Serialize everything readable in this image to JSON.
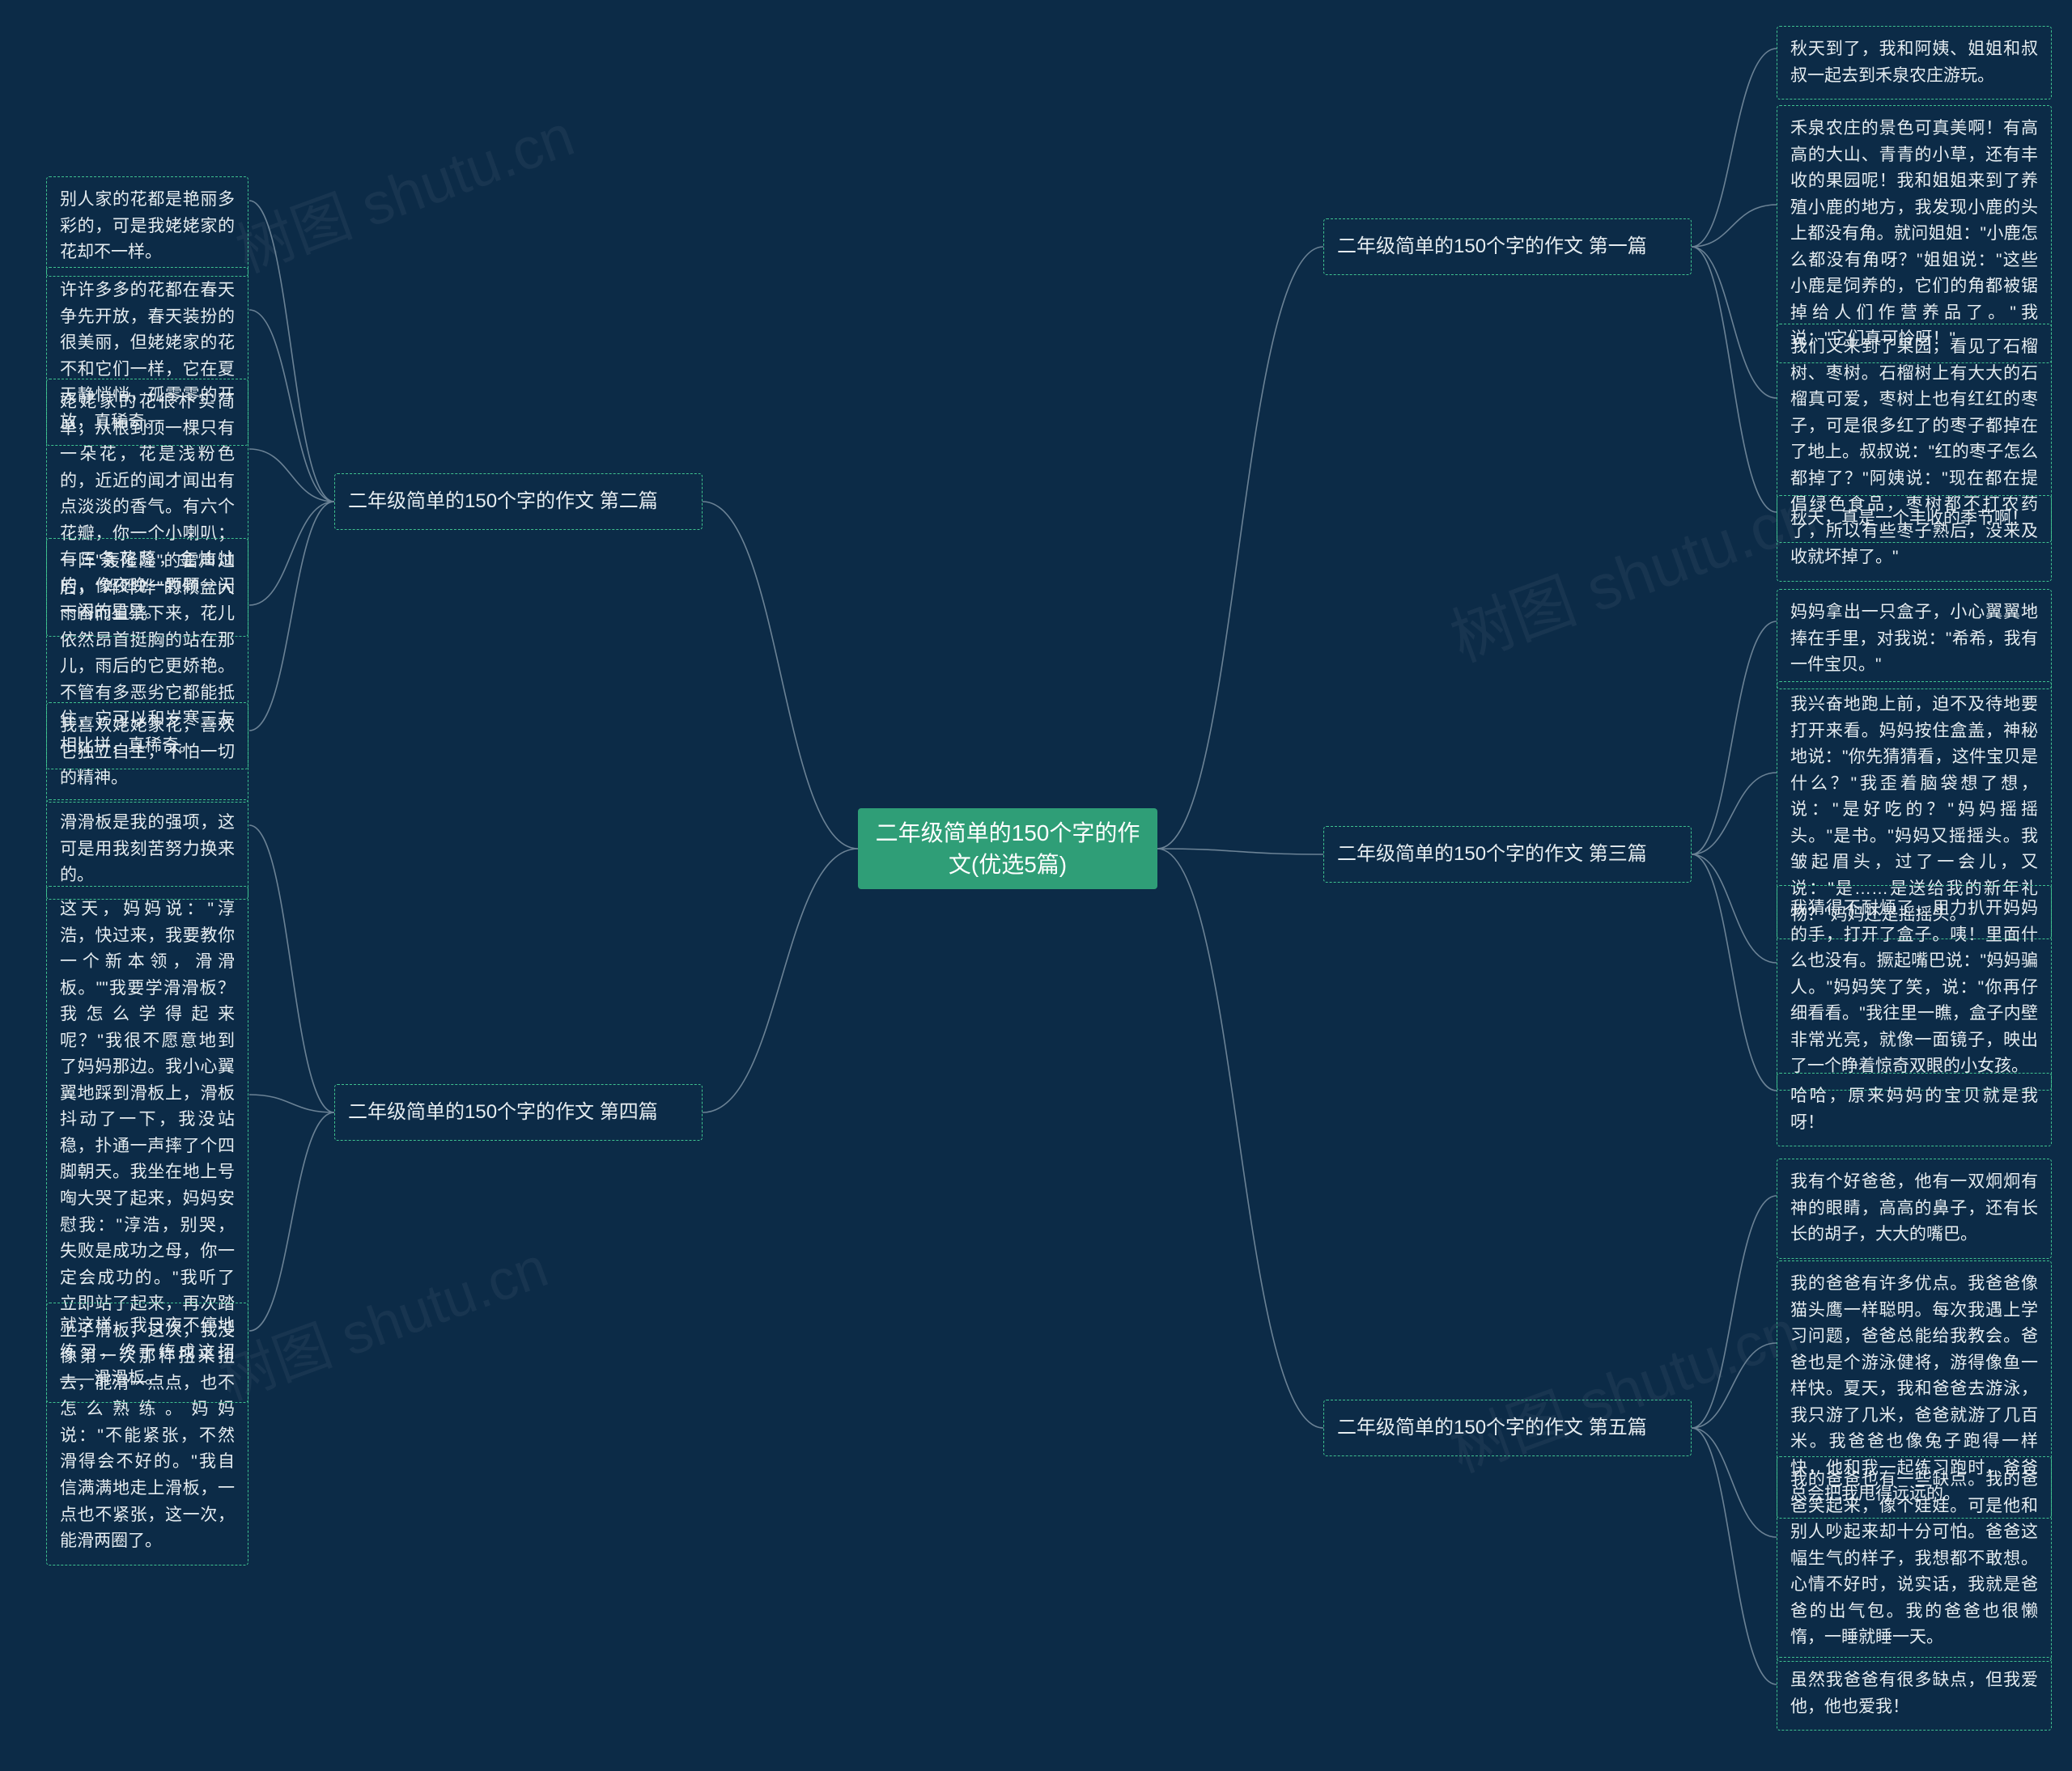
{
  "watermark_text_cn": "树图 shutu.cn",
  "center": {
    "title": "二年级简单的150个字的作文(优选5篇)"
  },
  "branches": {
    "b1": {
      "label": "二年级简单的150个字的作文 第一篇"
    },
    "b2": {
      "label": "二年级简单的150个字的作文 第二篇"
    },
    "b3": {
      "label": "二年级简单的150个字的作文 第三篇"
    },
    "b4": {
      "label": "二年级简单的150个字的作文 第四篇"
    },
    "b5": {
      "label": "二年级简单的150个字的作文 第五篇"
    }
  },
  "leaves": {
    "l1a": "秋天到了，我和阿姨、姐姐和叔叔一起去到禾泉农庄游玩。",
    "l1b": "禾泉农庄的景色可真美啊！有高高的大山、青青的小草，还有丰收的果园呢！我和姐姐来到了养殖小鹿的地方，我发现小鹿的头上都没有角。就问姐姐：\"小鹿怎么都没有角呀？\"姐姐说：\"这些小鹿是饲养的，它们的角都被锯掉给人们作营养品了。\"我说：\"它们真可怜呀！\"",
    "l1c": "我们又来到了果园，看见了石榴树、枣树。石榴树上有大大的石榴真可爱，枣树上也有红红的枣子，可是很多红了的枣子都掉在了地上。叔叔说：\"红的枣子怎么都掉了？\"阿姨说：\"现在都在提倡绿色食品，枣树都不打农药了，所以有些枣子熟后，没来及收就坏掉了。\"",
    "l1d": "秋天，真是一个丰收的季节啊！",
    "l2a": "别人家的花都是艳丽多彩的，可是我姥姥家的花却不一样。",
    "l2b": "许许多多的花都在春天争先开放，春天装扮的很美丽，但姥姥家的花不和它们一样，它在夏天静悄悄，孤零零的开放，真稀奇。",
    "l2c": "姥姥家的花很朴实简单，从根到顶一棵只有一朵花，花是浅粉色的，近近的闻才闻出有点淡淡的香气。有六个花瓣，你一个小喇叭；有三条花蕊，金灿灿的，像夜晚一颗颗一闪一闪的星星。",
    "l2d": "一阵\"轰隆隆\"的雷声过后，\"哗哗哗\"的倾盆大雨奋而直浇下来，花儿依然昂首挺胸的站在那儿，雨后的它更娇艳。不管有多恶劣它都能抵住，它可以和岁寒三友相比拼，真稀奇。",
    "l2e": "我喜欢姥姥家花，喜欢它独立自主，不怕一切的精神。",
    "l3a": "妈妈拿出一只盒子，小心翼翼地捧在手里，对我说：\"希希，我有一件宝贝。\"",
    "l3b": "我兴奋地跑上前，迫不及待地要打开来看。妈妈按住盒盖，神秘地说：\"你先猜猜看，这件宝贝是什么？\"我歪着脑袋想了想，说：\"是好吃的？\"妈妈摇摇头。\"是书。\"妈妈又摇摇头。我皱起眉头，过了一会儿，又说：\"是……是送给我的新年礼物？\"妈妈还是摇摇头。",
    "l3c": "我猜得不耐烦了，用力扒开妈妈的手，打开了盒子。咦！里面什么也没有。撅起嘴巴说：\"妈妈骗人。\"妈妈笑了笑，说：\"你再仔细看看。\"我往里一瞧，盒子内壁非常光亮，就像一面镜子，映出了一个睁着惊奇双眼的小女孩。",
    "l3d": "哈哈，原来妈妈的宝贝就是我呀！",
    "l4a": "滑滑板是我的强项，这可是用我刻苦努力换来的。",
    "l4b": "这天，妈妈说：\"淳浩，快过来，我要教你一个新本领，滑滑板。\"\"我要学滑滑板？我怎么学得起来呢？\"我很不愿意地到了妈妈那边。我小心翼翼地踩到滑板上，滑板抖动了一下，我没站稳，扑通一声摔了个四脚朝天。我坐在地上号啕大哭了起来，妈妈安慰我：\"淳浩，别哭，失败是成功之母，你一定会成功的。\"我听了立即站了起来，再次踏上了滑板，这次，我没像第一次那样扭来扭去，能滑一点点，也不怎么熟练。妈妈说：\"不能紧张，不然滑得会不好的。\"我自信满满地走上滑板，一点也不紧张，这一次，能滑两圈了。",
    "l4c": "就这样，我日夜不停地练习，终于练成这招——滑滑板。",
    "l5a": "我有个好爸爸，他有一双炯炯有神的眼睛，高高的鼻子，还有长长的胡子，大大的嘴巴。",
    "l5b": "我的爸爸有许多优点。我爸爸像猫头鹰一样聪明。每次我遇上学习问题，爸爸总能给我教会。爸爸也是个游泳健将，游得像鱼一样快。夏天，我和爸爸去游泳，我只游了几米，爸爸就游了几百米。我爸爸也像兔子跑得一样快，他和我一起练习跑时，爸爸总会把我甩得远远的。",
    "l5c": "我的爸爸也有一些缺点。我的爸爸笑起来，像个娃娃。可是他和别人吵起来却十分可怕。爸爸这幅生气的样子，我想都不敢想。心情不好时，说实话，我就是爸爸的出气包。我的爸爸也很懒惰，一睡就睡一天。",
    "l5d": "虽然我爸爸有很多缺点，但我爱他，他也爱我！"
  }
}
